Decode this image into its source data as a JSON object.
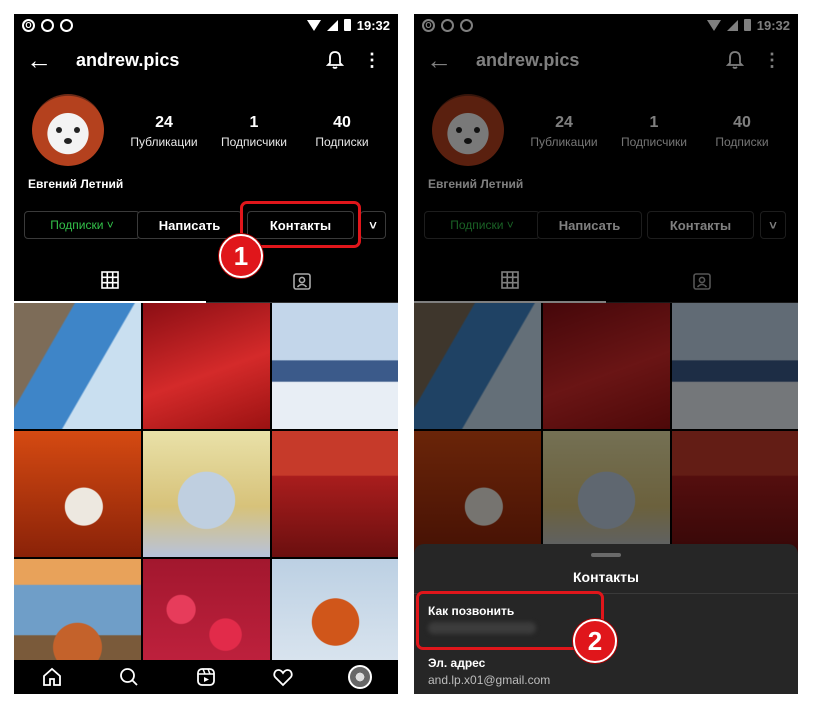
{
  "status_bar": {
    "time": "19:32"
  },
  "profile": {
    "username": "andrew.pics",
    "name": "Евгений Летний",
    "stats": [
      {
        "value": "24",
        "label": "Публикации"
      },
      {
        "value": "1",
        "label": "Подписчики"
      },
      {
        "value": "40",
        "label": "Подписки"
      }
    ]
  },
  "actions": {
    "subscriptions": "Подписки",
    "message": "Написать",
    "contacts": "Контакты"
  },
  "steps": {
    "one": "1",
    "two": "2"
  },
  "sheet": {
    "title": "Контакты",
    "call_label": "Как позвонить",
    "email_label": "Эл. адрес",
    "email_value": "and.lp.x01@gmail.com"
  },
  "photos": [
    "owl",
    "red-feather",
    "white-wolf",
    "cat-autumn",
    "white-fox",
    "red-tulips",
    "fox-sea",
    "raspberries",
    "fox-snow"
  ],
  "colors": {
    "accent_red": "#e0161b",
    "subscriptions_green": "#33c24a"
  }
}
